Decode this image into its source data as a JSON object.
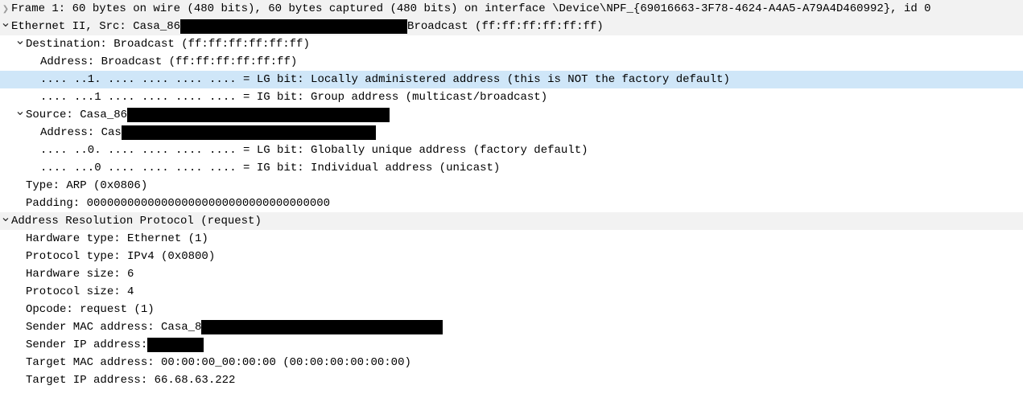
{
  "frame": {
    "summary": "Frame 1: 60 bytes on wire (480 bits), 60 bytes captured (480 bits) on interface \\Device\\NPF_{69016663-3F78-4624-A4A5-A79A4D460992}, id 0"
  },
  "eth": {
    "summary_prefix": "Ethernet II, Src: Casa_86",
    "summary_suffix": " Broadcast (ff:ff:ff:ff:ff:ff)",
    "dst": {
      "summary": "Destination: Broadcast (ff:ff:ff:ff:ff:ff)",
      "address": "Address: Broadcast (ff:ff:ff:ff:ff:ff)",
      "lg_bit": ".... ..1. .... .... .... .... = LG bit: Locally administered address (this is NOT the factory default)",
      "ig_bit": ".... ...1 .... .... .... .... = IG bit: Group address (multicast/broadcast)"
    },
    "src": {
      "summary_prefix": "Source: Casa_86",
      "address_prefix": "Address: Cas",
      "lg_bit": ".... ..0. .... .... .... .... = LG bit: Globally unique address (factory default)",
      "ig_bit": ".... ...0 .... .... .... .... = IG bit: Individual address (unicast)"
    },
    "type": "Type: ARP (0x0806)",
    "padding": "Padding: 000000000000000000000000000000000000"
  },
  "arp": {
    "summary": "Address Resolution Protocol (request)",
    "hw_type": "Hardware type: Ethernet (1)",
    "proto_type": "Protocol type: IPv4 (0x0800)",
    "hw_size": "Hardware size: 6",
    "proto_size": "Protocol size: 4",
    "opcode": "Opcode: request (1)",
    "sender_mac_prefix": "Sender MAC address: Casa_8",
    "sender_ip_prefix": "Sender IP address:",
    "target_mac": "Target MAC address: 00:00:00_00:00:00 (00:00:00:00:00:00)",
    "target_ip": "Target IP address: 66.68.63.222"
  }
}
